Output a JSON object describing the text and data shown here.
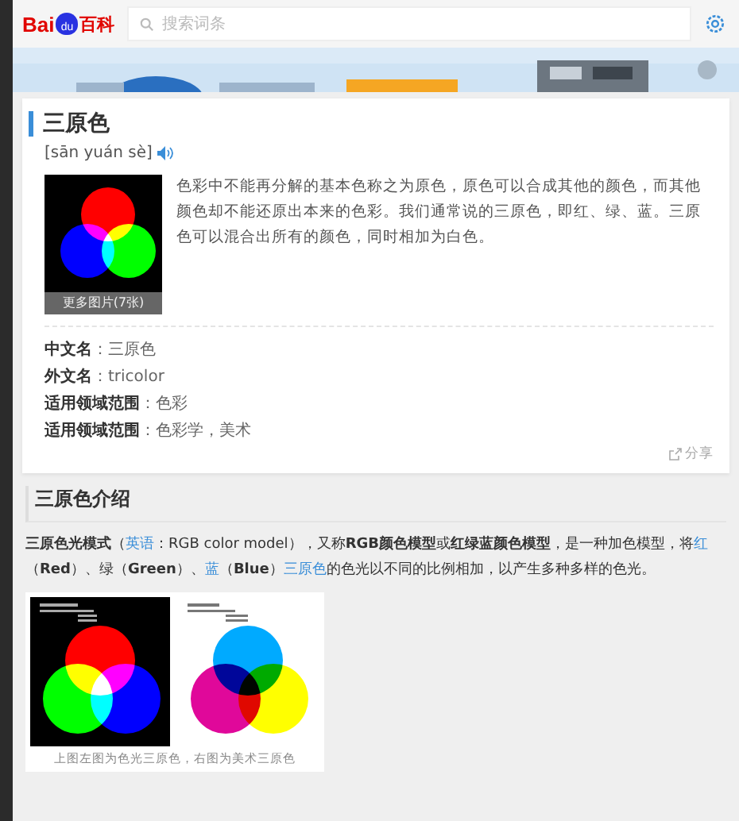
{
  "header": {
    "logo": {
      "left": "Bai",
      "paw": "du",
      "right": "百科"
    },
    "search": {
      "placeholder": "搜索词条"
    }
  },
  "entry": {
    "title": "三原色",
    "pinyin": "[sān yuán sè]",
    "thumbnail_caption": "更多图片(7张)",
    "summary": "色彩中不能再分解的基本色称之为原色，原色可以合成其他的颜色，而其他颜色却不能还原出本来的色彩。我们通常说的三原色，即红、绿、蓝。三原色可以混合出所有的颜色，同时相加为白色。",
    "info": [
      {
        "label": "中文名",
        "value": "：三原色"
      },
      {
        "label": "外文名",
        "value": "：tricolor"
      },
      {
        "label": "适用领域范围",
        "value": "：色彩"
      },
      {
        "label": "适用领域范围",
        "value": "：色彩学，美术"
      }
    ],
    "share": "分享"
  },
  "section": {
    "title": "三原色介绍",
    "paragraph": [
      {
        "kind": "bold",
        "text": "三原色光模式"
      },
      {
        "kind": "plain",
        "text": "（"
      },
      {
        "kind": "link",
        "text": "英语"
      },
      {
        "kind": "plain",
        "text": "：RGB color model），又称"
      },
      {
        "kind": "bold",
        "text": "RGB颜色模型"
      },
      {
        "kind": "plain",
        "text": "或"
      },
      {
        "kind": "bold",
        "text": "红绿蓝颜色模型"
      },
      {
        "kind": "plain",
        "text": "，是一种加色模型，将"
      },
      {
        "kind": "link",
        "text": "红"
      },
      {
        "kind": "plain",
        "text": "（"
      },
      {
        "kind": "bold",
        "text": "Red"
      },
      {
        "kind": "plain",
        "text": "）、绿（"
      },
      {
        "kind": "bold",
        "text": "Green"
      },
      {
        "kind": "plain",
        "text": "）、"
      },
      {
        "kind": "link",
        "text": "蓝"
      },
      {
        "kind": "plain",
        "text": "（"
      },
      {
        "kind": "bold",
        "text": "Blue"
      },
      {
        "kind": "plain",
        "text": "）"
      },
      {
        "kind": "link",
        "text": "三原色"
      },
      {
        "kind": "plain",
        "text": "的色光以不同的比例相加，以产生多种多样的色光。"
      }
    ],
    "figure_caption": "上图左图为色光三原色，右图为美术三原色"
  }
}
